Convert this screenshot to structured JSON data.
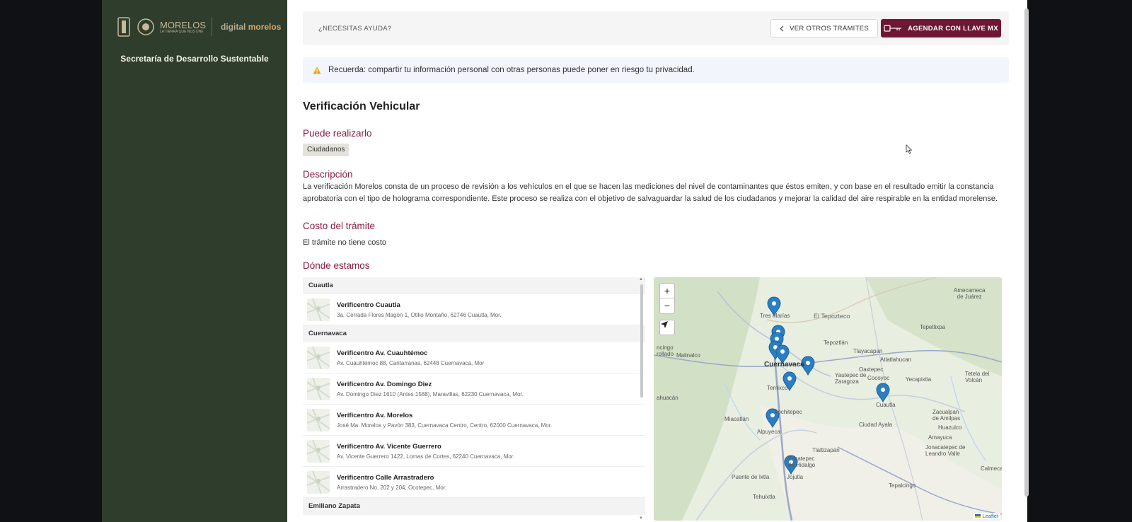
{
  "sidebar": {
    "logo_text": "MORELOS",
    "logo_sub": "LA TIERRA QUE NOS UNE",
    "digital_prefix": "digital",
    "digital_brand": "morelos",
    "secretaria": "Secretaría de Desarrollo Sustentable"
  },
  "topbar": {
    "help": "¿NECESITAS AYUDA?",
    "other_label": "VER OTROS TRÁMITES",
    "llave_label": "AGENDAR CON LLAVE MX"
  },
  "alert": {
    "text": "Recuerda: compartir tu información personal con otras personas puede poner en riesgo tu privacidad."
  },
  "page": {
    "title": "Verificación Vehicular",
    "who_heading": "Puede realizarlo",
    "who_tag": "Ciudadanos",
    "desc_heading": "Descripción",
    "description": "La verificación Morelos consta de un proceso de revisión a los vehículos en el que se hacen las mediciones del nivel de contaminantes que éstos emiten, y con base en el resultado emitir la constancia aprobatoria con el tipo de holograma correspondiente. Este proceso se realiza con el objetivo de salvaguardar la salud de los ciudadanos y mejorar la calidad del aire respirable en la entidad morelense.",
    "cost_heading": "Costo del trámite",
    "cost": "El trámite no tiene costo",
    "where_heading": "Dónde estamos"
  },
  "locations": {
    "group_cuautla": "Cuautla",
    "group_cuernavaca": "Cuernavaca",
    "group_emiliano": "Emiliano Zapata",
    "items": [
      {
        "name": "Verificentro Cuautla",
        "address": "3a. Cerrada Flores Magón 1, Otilio Montaño, 62746 Cuautla, Mor."
      },
      {
        "name": "Verificentro Av. Cuauhtémoc",
        "address": "Av. Cuauhtémoc 88, Cantarranas, 62448 Cuernavaca, Mor"
      },
      {
        "name": "Verificentro Av. Domingo Diez",
        "address": "Av. Domingo Diez 1610 (Antes 1588), Maravillas, 62230 Cuernavaca, Mor."
      },
      {
        "name": "Verificentro Av. Morelos",
        "address": "José Ma. Morelos y Pavón 383, Cuernavaca Centro, Centro, 62000 Cuernavaca, Mor."
      },
      {
        "name": "Verificentro Av. Vicente Guerrero",
        "address": "Av. Vicente Guerrero 1422, Lomas de Cortes, 62240 Cuernavaca, Mor."
      },
      {
        "name": "Verificentro Calle Arrastradero",
        "address": "Arrastradero No. 202 y 204, Ocotepec, Mor."
      }
    ]
  },
  "map": {
    "zoom_in": "+",
    "zoom_out": "−",
    "attribution": "Leaflet",
    "labels": {
      "tres_marias": "Tres Marías",
      "el_tepozteco": "El Tepozteco",
      "amecameca": "Amecameca\nde Juárez",
      "tepetlixpa": "Tepetlixpa",
      "tepoztlan": "Tepoztlán",
      "tlayacapan": "Tlayacapan",
      "atlatlahucan": "Atlatlahucan",
      "malinalco": "Malinalco",
      "cuernavaca": "Cuernavaca",
      "oaxtepec": "Oaxtepec",
      "yautepec": "Yautepec de\nZaragoza",
      "cocoyoc": "Cocoyoc",
      "yecapixtla": "Yecapixtla",
      "tetela": "Tetela del\nVolcán",
      "temixco": "Temixco",
      "cuautla": "Cuautla",
      "zacualpan": "Zacualpan\nde Amilpas",
      "huazulco": "Huazulco",
      "xochitepec": "Xochitepec",
      "miacatlan": "Miacatlán",
      "alpuyeca": "Alpuyeca",
      "ciudad_ayala": "Ciudad Ayala",
      "amayuca": "Amayuca",
      "tlaltizapan": "Tlaltizapán",
      "jonacatepec": "Jonacatepec de\nLeandro Valle",
      "zacatepec": "Zacatepec\nde Hidalgo",
      "jojutla": "Jojutla",
      "puente_ixtla": "Puente de Ixtla",
      "tehuixtla": "Tehuixtla",
      "tepalcingo": "Tepalcingo",
      "calmeca": "Calmeca",
      "ahuacan": "ahuacán",
      "tenancingo": "ncingo\nrollado"
    }
  },
  "colors": {
    "sidebar": "#2e3d2c",
    "accent": "#8a1c3d",
    "button": "#6e1734",
    "marker": "#2a7fc4"
  }
}
